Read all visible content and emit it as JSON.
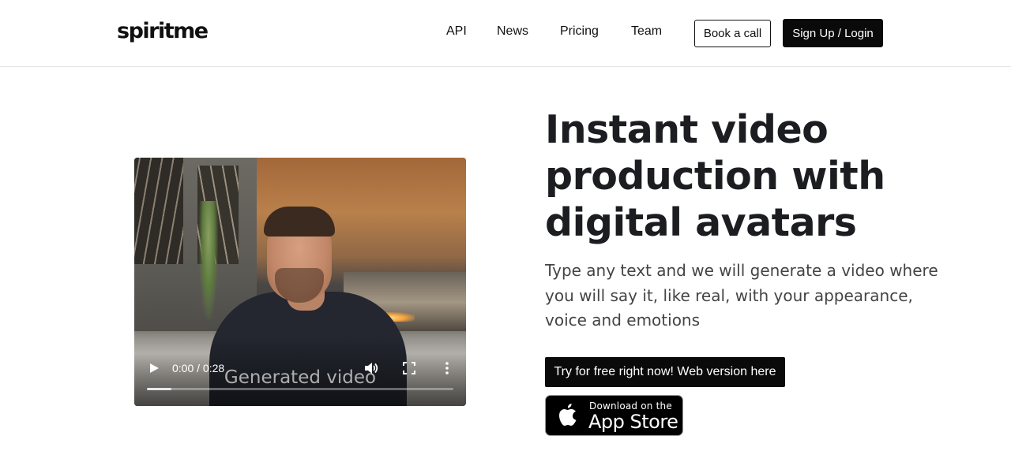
{
  "header": {
    "logo": "spiritme",
    "nav": [
      "API",
      "News",
      "Pricing",
      "Team"
    ],
    "book_call_label": "Book a call",
    "signup_label": "Sign Up / Login"
  },
  "video": {
    "caption": "Generated video",
    "time": "0:00 / 0:28",
    "progress_fraction": 0.08,
    "icons": [
      "play-icon",
      "volume-icon",
      "fullscreen-icon",
      "more-options-icon"
    ]
  },
  "hero": {
    "headline_lines": [
      "Instant video",
      "production with",
      "digital avatars"
    ],
    "subtitle": "Type any text and we will generate a video where you will say it, like real, with your appearance, voice and emotions",
    "cta_label": "Try for free right now! Web version here",
    "appstore_small": "Download on the",
    "appstore_big": "App Store"
  }
}
